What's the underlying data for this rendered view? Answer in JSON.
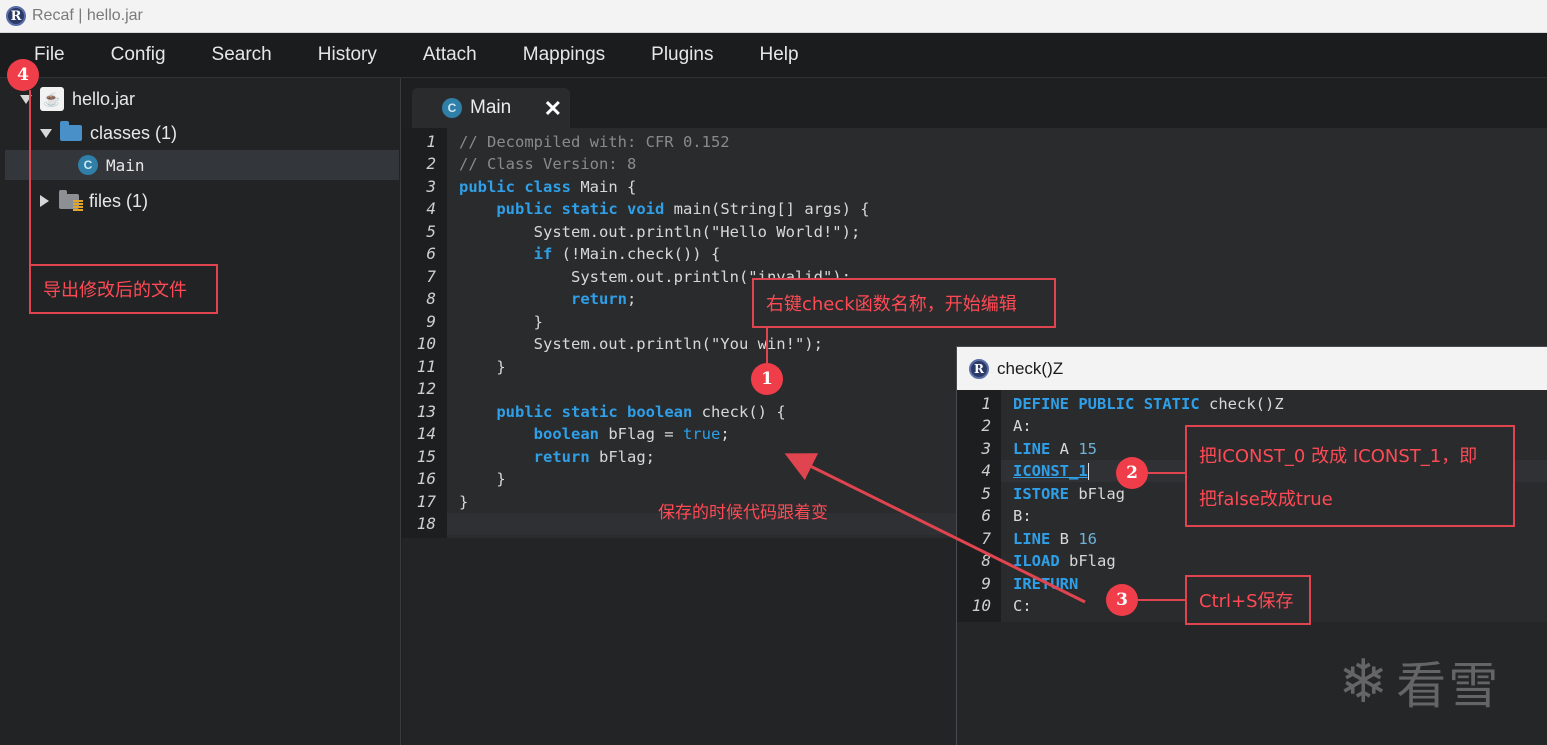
{
  "window": {
    "title": "Recaf | hello.jar",
    "logo_letter": "R"
  },
  "menu": [
    "File",
    "Config",
    "Search",
    "History",
    "Attach",
    "Mappings",
    "Plugins",
    "Help"
  ],
  "tree": {
    "jar": "hello.jar",
    "classes_folder": "classes (1)",
    "class_item": "Main",
    "files_folder": "files (1)",
    "class_icon_letter": "C"
  },
  "tab": {
    "label": "Main",
    "close": "✕",
    "icon_letter": "C"
  },
  "editor": {
    "line_numbers": [
      "1",
      "2",
      "3",
      "4",
      "5",
      "6",
      "7",
      "8",
      "9",
      "10",
      "11",
      "12",
      "13",
      "14",
      "15",
      "16",
      "17",
      "18"
    ]
  },
  "popup": {
    "title": "check()Z",
    "line_numbers": [
      "1",
      "2",
      "3",
      "4",
      "5",
      "6",
      "7",
      "8",
      "9",
      "10"
    ]
  },
  "annotations": {
    "a1_text": "右键check函数名称，开始编辑",
    "a1_num": "1",
    "a2_text_line1": "把ICONST_0 改成 ICONST_1，即",
    "a2_text_line2": "把false改成true",
    "a2_num": "2",
    "a3_text": "Ctrl+S保存",
    "a3_num": "3",
    "a4_text": "导出修改后的文件",
    "a4_num": "4",
    "save_note": "保存的时候代码跟着变"
  },
  "watermark": {
    "symbol": "❄",
    "text": "看雪"
  },
  "colors": {
    "keyword": "#2f9fe8",
    "annotation": "#e0454f",
    "badge": "#ef3e4a"
  }
}
